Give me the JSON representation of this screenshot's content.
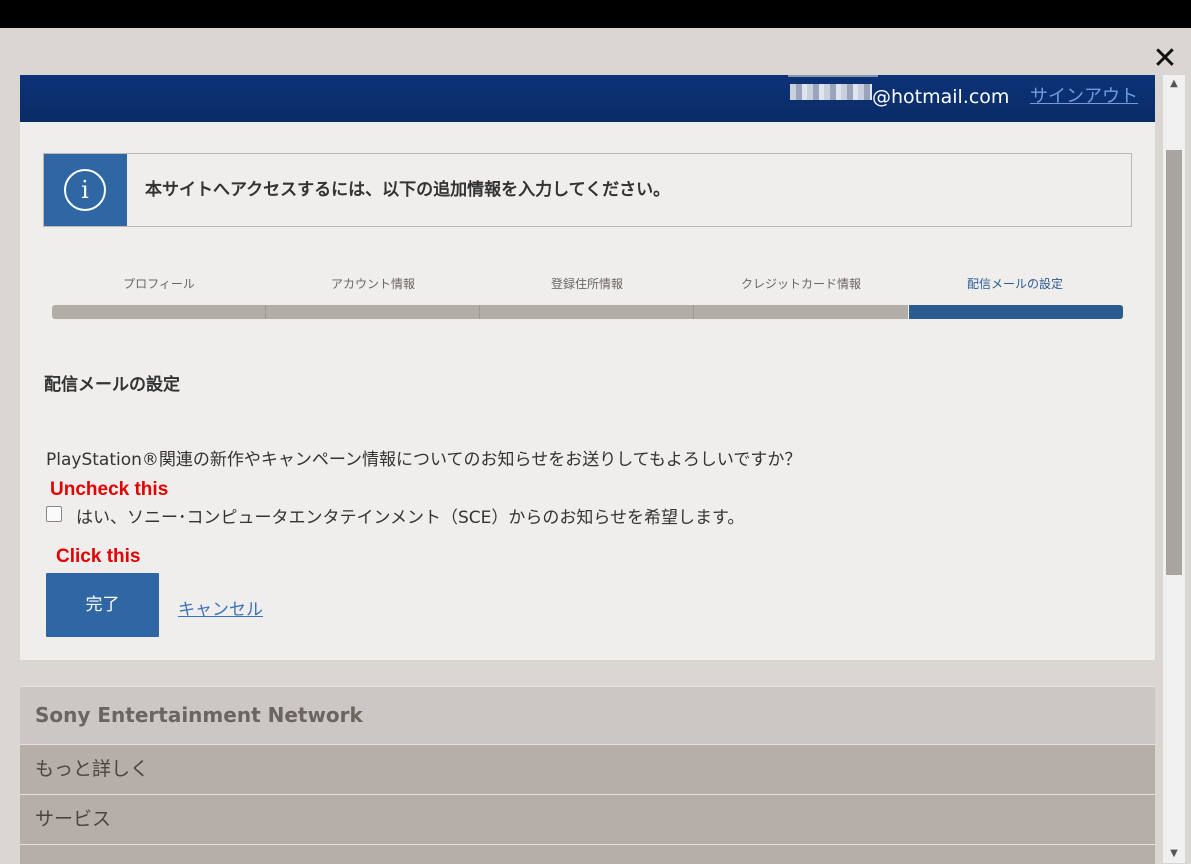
{
  "window": {
    "close_icon": "close-icon"
  },
  "header": {
    "email": "@hotmail.com",
    "signout_label": "サインアウト"
  },
  "info": {
    "icon": "info-icon",
    "icon_glyph": "i",
    "message": "本サイトへアクセスするには、以下の追加情報を入力してください。"
  },
  "steps": [
    {
      "label": "プロフィール",
      "active": false
    },
    {
      "label": "アカウント情報",
      "active": false
    },
    {
      "label": "登録住所情報",
      "active": false
    },
    {
      "label": "クレジットカード情報",
      "active": false
    },
    {
      "label": "配信メールの設定",
      "active": true
    }
  ],
  "section": {
    "title": "配信メールの設定",
    "question": "PlayStation®関連の新作やキャンペーン情報についてのお知らせをお送りしてもよろしいですか？",
    "checkbox_label": "はい、ソニー･コンピュータエンタテインメント（SCE）からのお知らせを希望します。",
    "checkbox_checked": false
  },
  "annotations": {
    "uncheck": "Uncheck this",
    "click": "Click this"
  },
  "actions": {
    "done_label": "完了",
    "cancel_label": "キャンセル"
  },
  "footer": {
    "title": "Sony Entertainment Network",
    "items": [
      "もっと詳しく",
      "サービス"
    ]
  },
  "colors": {
    "header_bg": "#0a2b66",
    "accent": "#2e67a3",
    "annotation_red": "#e40000"
  }
}
